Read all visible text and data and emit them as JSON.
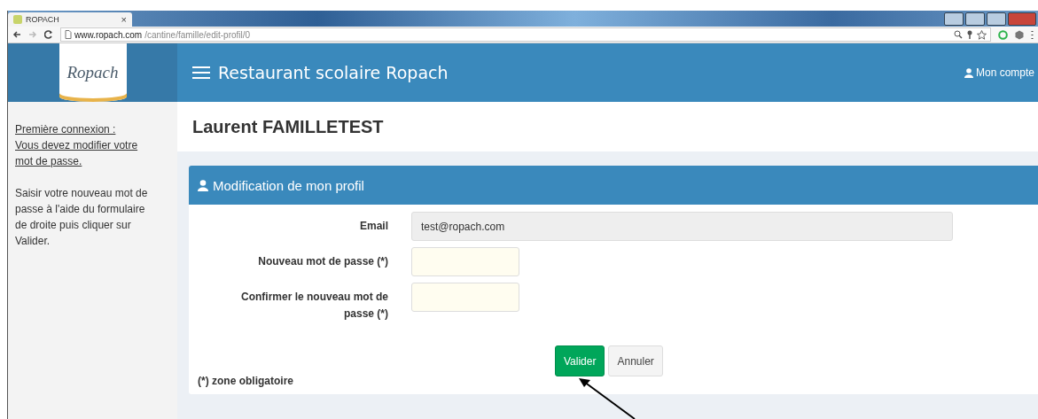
{
  "browser": {
    "tab_title": "ROPACH",
    "tab_close": "×",
    "url_host": "www.ropach.com",
    "url_path": "/cantine/famille/edit-profil/0"
  },
  "header": {
    "logo_text": "Ropach",
    "title": "Restaurant scolaire Ropach",
    "account": "Mon compte"
  },
  "sidebar": {
    "notice_lines": [
      "Première connexion :",
      "Vous devez modifier votre mot de passe."
    ],
    "help": "Saisir votre nouveau mot de passe à l'aide du formulaire de droite puis cliquer sur Valider."
  },
  "page_title": "Laurent FAMILLETEST",
  "panel": {
    "title": "Modification de mon profil",
    "fields": [
      {
        "label": "Email",
        "value": "test@ropach.com",
        "readonly": true,
        "kind": "email"
      },
      {
        "label": "Nouveau mot de passe (*)",
        "readonly": false,
        "kind": "password"
      },
      {
        "label": "Confirmer le nouveau mot de passe (*)",
        "readonly": false,
        "kind": "password"
      }
    ],
    "buttons": [
      {
        "label": "Valider",
        "kind": "primary"
      },
      {
        "label": "Annuler",
        "kind": "default"
      }
    ],
    "footnote": "(*) zone obligatoire"
  }
}
